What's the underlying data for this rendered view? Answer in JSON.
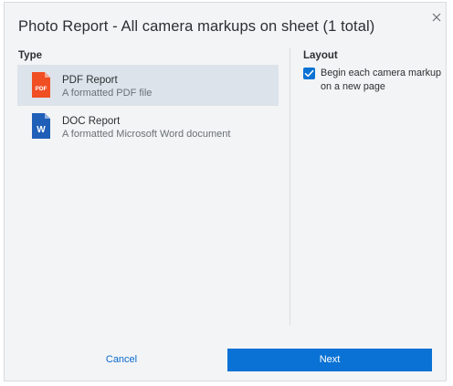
{
  "dialog": {
    "title": "Photo Report - All camera markups on sheet (1 total)"
  },
  "type_section": {
    "heading": "Type",
    "items": [
      {
        "name": "PDF Report",
        "description": "A formatted PDF file",
        "icon": "pdf-file-icon",
        "icon_text": "PDF",
        "icon_color": "#f04e23",
        "selected": true
      },
      {
        "name": "DOC Report",
        "description": "A formatted Microsoft Word document",
        "icon": "word-file-icon",
        "icon_text": "W",
        "icon_color": "#1f5fb8",
        "selected": false
      }
    ]
  },
  "layout_section": {
    "heading": "Layout",
    "checkbox_label": "Begin each camera markup on a new page",
    "checked": true
  },
  "footer": {
    "cancel_label": "Cancel",
    "next_label": "Next"
  },
  "colors": {
    "accent": "#0a72d4",
    "selected_row": "#dde3ea",
    "background": "#f3f4f5"
  }
}
